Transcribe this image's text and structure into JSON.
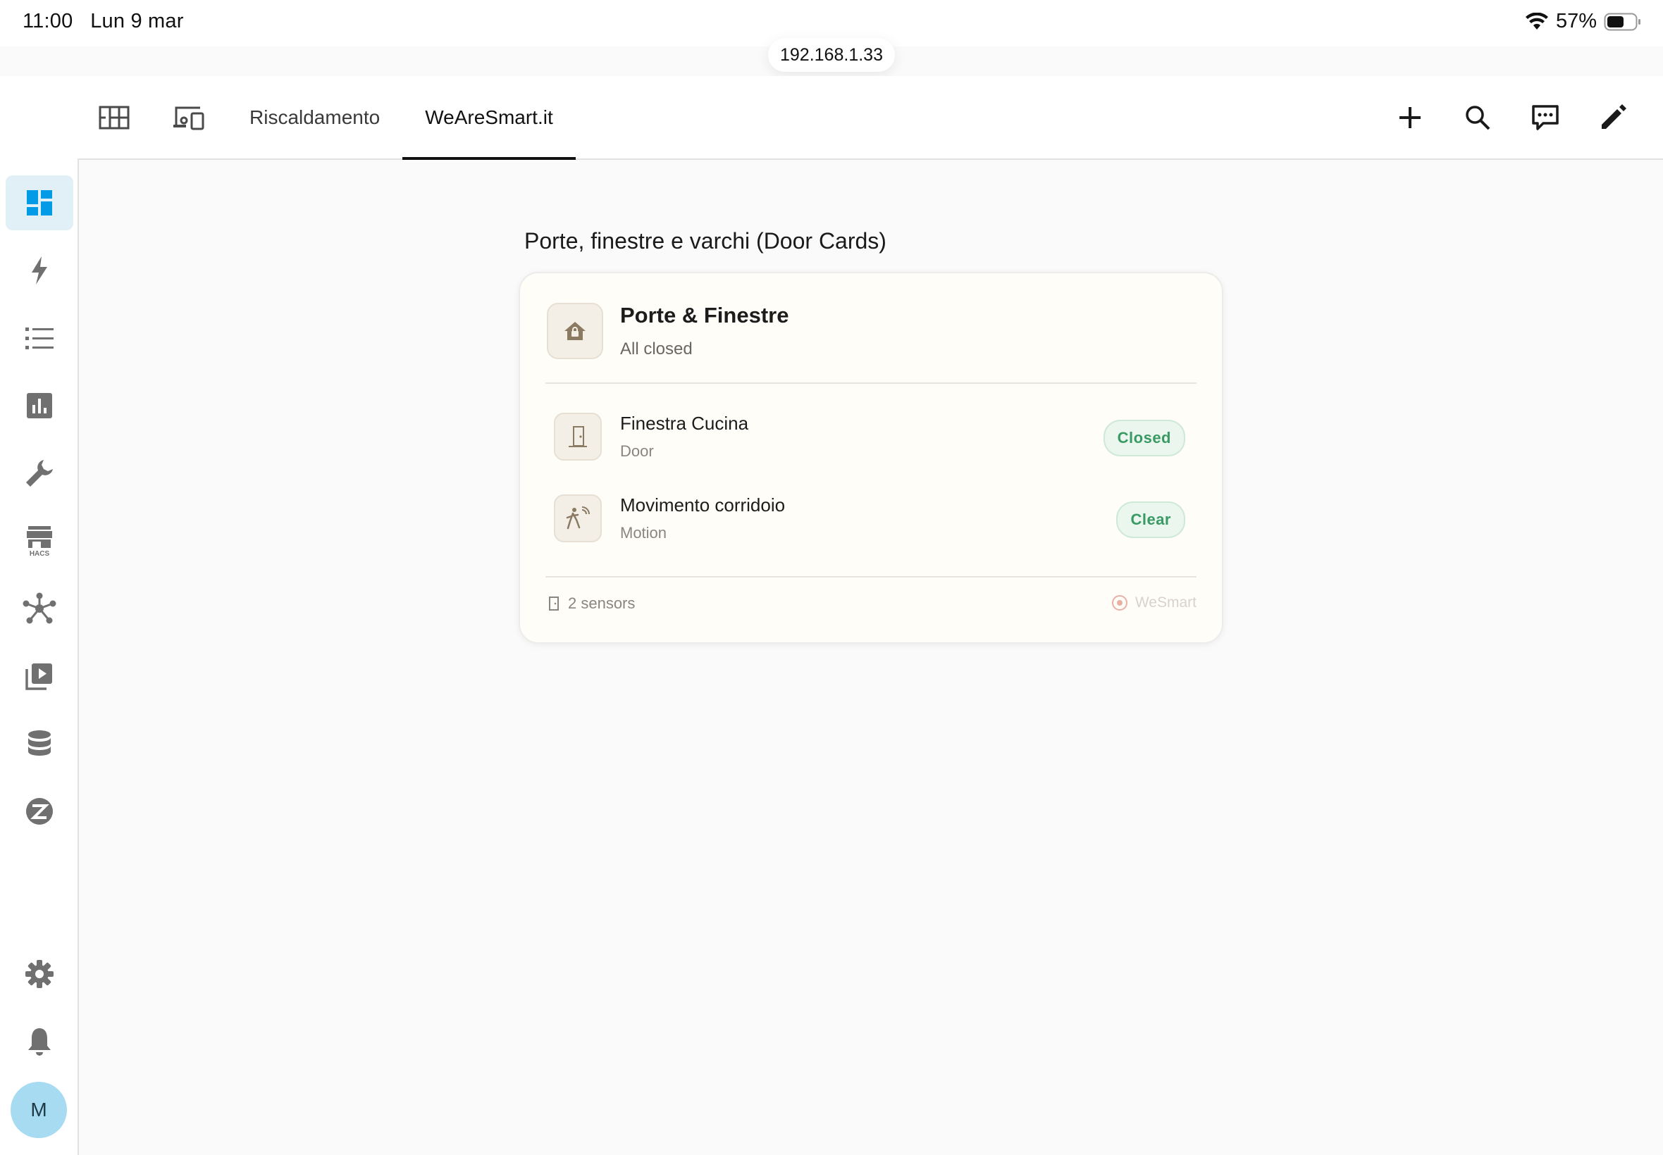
{
  "status_bar": {
    "time": "11:00",
    "date": "Lun 9 mar",
    "battery_percent": "57%",
    "url": "192.168.1.33"
  },
  "topbar": {
    "tabs": [
      {
        "label": "Riscaldamento"
      },
      {
        "label": "WeAreSmart.it",
        "active": true
      }
    ],
    "icon_tabs": [
      "floorplan-icon",
      "devices-icon"
    ],
    "actions": [
      "add-icon",
      "search-icon",
      "assist-icon",
      "edit-icon"
    ]
  },
  "sidebar": {
    "items": [
      {
        "name": "overview",
        "icon": "dashboard-icon",
        "active": true
      },
      {
        "name": "energy",
        "icon": "lightning-icon"
      },
      {
        "name": "logbook",
        "icon": "list-icon"
      },
      {
        "name": "history",
        "icon": "chart-icon"
      },
      {
        "name": "developer-tools",
        "icon": "wrench-icon"
      },
      {
        "name": "hacs",
        "icon": "hacs-store-icon",
        "label": "HACS"
      },
      {
        "name": "nodes",
        "icon": "network-icon"
      },
      {
        "name": "media",
        "icon": "media-play-icon"
      },
      {
        "name": "database",
        "icon": "database-icon"
      },
      {
        "name": "z-wave",
        "icon": "zwave-icon"
      },
      {
        "name": "settings",
        "icon": "gear-icon"
      },
      {
        "name": "notifications",
        "icon": "bell-icon"
      }
    ],
    "avatar_initial": "M"
  },
  "main": {
    "section_title": "Porte, finestre e varchi (Door Cards)",
    "card": {
      "title": "Porte & Finestre",
      "subtitle": "All closed",
      "sensors": [
        {
          "name": "Finestra Cucina",
          "type": "Door",
          "state": "Closed",
          "icon": "door-icon"
        },
        {
          "name": "Movimento corridoio",
          "type": "Motion",
          "state": "Clear",
          "icon": "motion-icon"
        }
      ],
      "footer_count": "2 sensors",
      "footer_brand": "WeSmart"
    }
  },
  "colors": {
    "accent": "#03a9f4",
    "badge_text": "#3a9a63",
    "card_bg": "#fffdf8",
    "active_nav_bg": "#e1f0f6"
  }
}
